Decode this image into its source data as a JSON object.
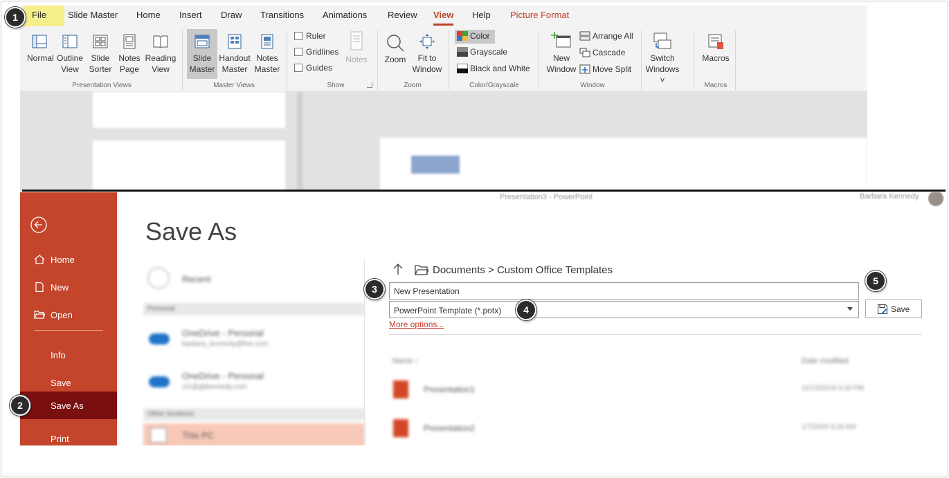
{
  "ribbon": {
    "tabs": [
      "File",
      "Slide Master",
      "Home",
      "Insert",
      "Draw",
      "Transitions",
      "Animations",
      "Review",
      "View",
      "Help",
      "Picture Format"
    ],
    "active_tab": "View",
    "presentation_views": {
      "normal": "Normal",
      "outline": [
        "Outline",
        "View"
      ],
      "sorter": [
        "Slide",
        "Sorter"
      ],
      "notes_page": [
        "Notes",
        "Page"
      ],
      "reading": [
        "Reading",
        "View"
      ],
      "label": "Presentation Views"
    },
    "master_views": {
      "slide_master": [
        "Slide",
        "Master"
      ],
      "handout_master": [
        "Handout",
        "Master"
      ],
      "notes_master": [
        "Notes",
        "Master"
      ],
      "label": "Master Views"
    },
    "show": {
      "ruler": "Ruler",
      "gridlines": "Gridlines",
      "guides": "Guides",
      "notes": "Notes",
      "label": "Show"
    },
    "zoom": {
      "zoom": "Zoom",
      "fit": [
        "Fit to",
        "Window"
      ],
      "label": "Zoom"
    },
    "color": {
      "color": "Color",
      "grayscale": "Grayscale",
      "bw": "Black and White",
      "label": "Color/Grayscale"
    },
    "window": {
      "new_window": [
        "New",
        "Window"
      ],
      "arrange_all": "Arrange All",
      "cascade": "Cascade",
      "move_split": "Move Split",
      "switch": [
        "Switch",
        "Windows ˅"
      ],
      "label": "Window"
    },
    "macros": {
      "macros": "Macros",
      "label": "Macros"
    }
  },
  "backstage": {
    "window_title": "Presentation3  -  PowerPoint",
    "user": "Barbara Kennedy",
    "nav": {
      "home": "Home",
      "new": "New",
      "open": "Open",
      "info": "Info",
      "save": "Save",
      "save_as": "Save As",
      "print": "Print"
    },
    "page_title": "Save As",
    "places": {
      "recent": "Recent",
      "personal_header": "Personal",
      "onedrive_1": "OneDrive - Personal",
      "onedrive_1_sub": "barbara_kennedy@live.com",
      "onedrive_2": "OneDrive - Personal",
      "onedrive_2_sub": "ul1@gbkennedy.com",
      "other_header": "Other locations",
      "this_pc": "This PC"
    },
    "path": "Documents > Custom Office Templates",
    "filename_value": "New Presentation",
    "filetype_value": "PowerPoint Template (*.potx)",
    "more_options": "More options...",
    "save_button": "Save",
    "file_list": {
      "col_name": "Name ↑",
      "col_date": "Date modified",
      "rows": [
        {
          "name": "Presentation1",
          "date": "12/13/2019 3:20 PM"
        },
        {
          "name": "Presentation2",
          "date": "1/7/2020 6:29 AM"
        }
      ]
    }
  },
  "callouts": [
    "1",
    "2",
    "3",
    "4",
    "5"
  ],
  "colors": {
    "accent": "#c4452b",
    "accent_dark": "#7a0f10",
    "file_tab": "#f4ef8a",
    "active_tab": "#b7472a"
  }
}
